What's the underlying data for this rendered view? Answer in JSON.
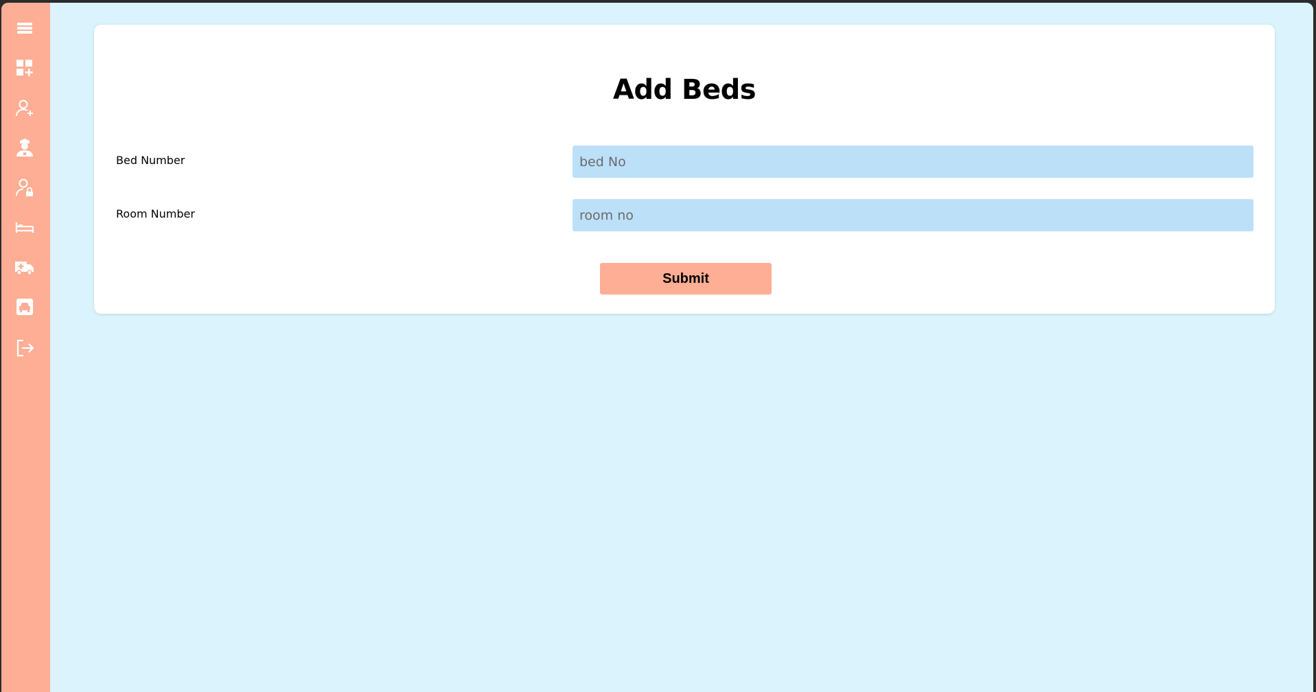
{
  "sidebar": {
    "icons": [
      {
        "name": "menu-icon"
      },
      {
        "name": "dashboard-add-icon"
      },
      {
        "name": "add-user-icon"
      },
      {
        "name": "nurse-icon"
      },
      {
        "name": "user-lock-icon"
      },
      {
        "name": "bed-icon"
      },
      {
        "name": "ambulance-icon"
      },
      {
        "name": "car-icon"
      },
      {
        "name": "logout-icon"
      }
    ],
    "color": "#fdae94"
  },
  "form": {
    "title": "Add Beds",
    "bed_number": {
      "label": "Bed Number",
      "placeholder": "bed No",
      "value": ""
    },
    "room_number": {
      "label": "Room Number",
      "placeholder": "room no",
      "value": ""
    },
    "submit_label": "Submit"
  },
  "colors": {
    "background": "#daf3fc",
    "input_bg": "#bde0f9",
    "accent": "#fdae94"
  }
}
